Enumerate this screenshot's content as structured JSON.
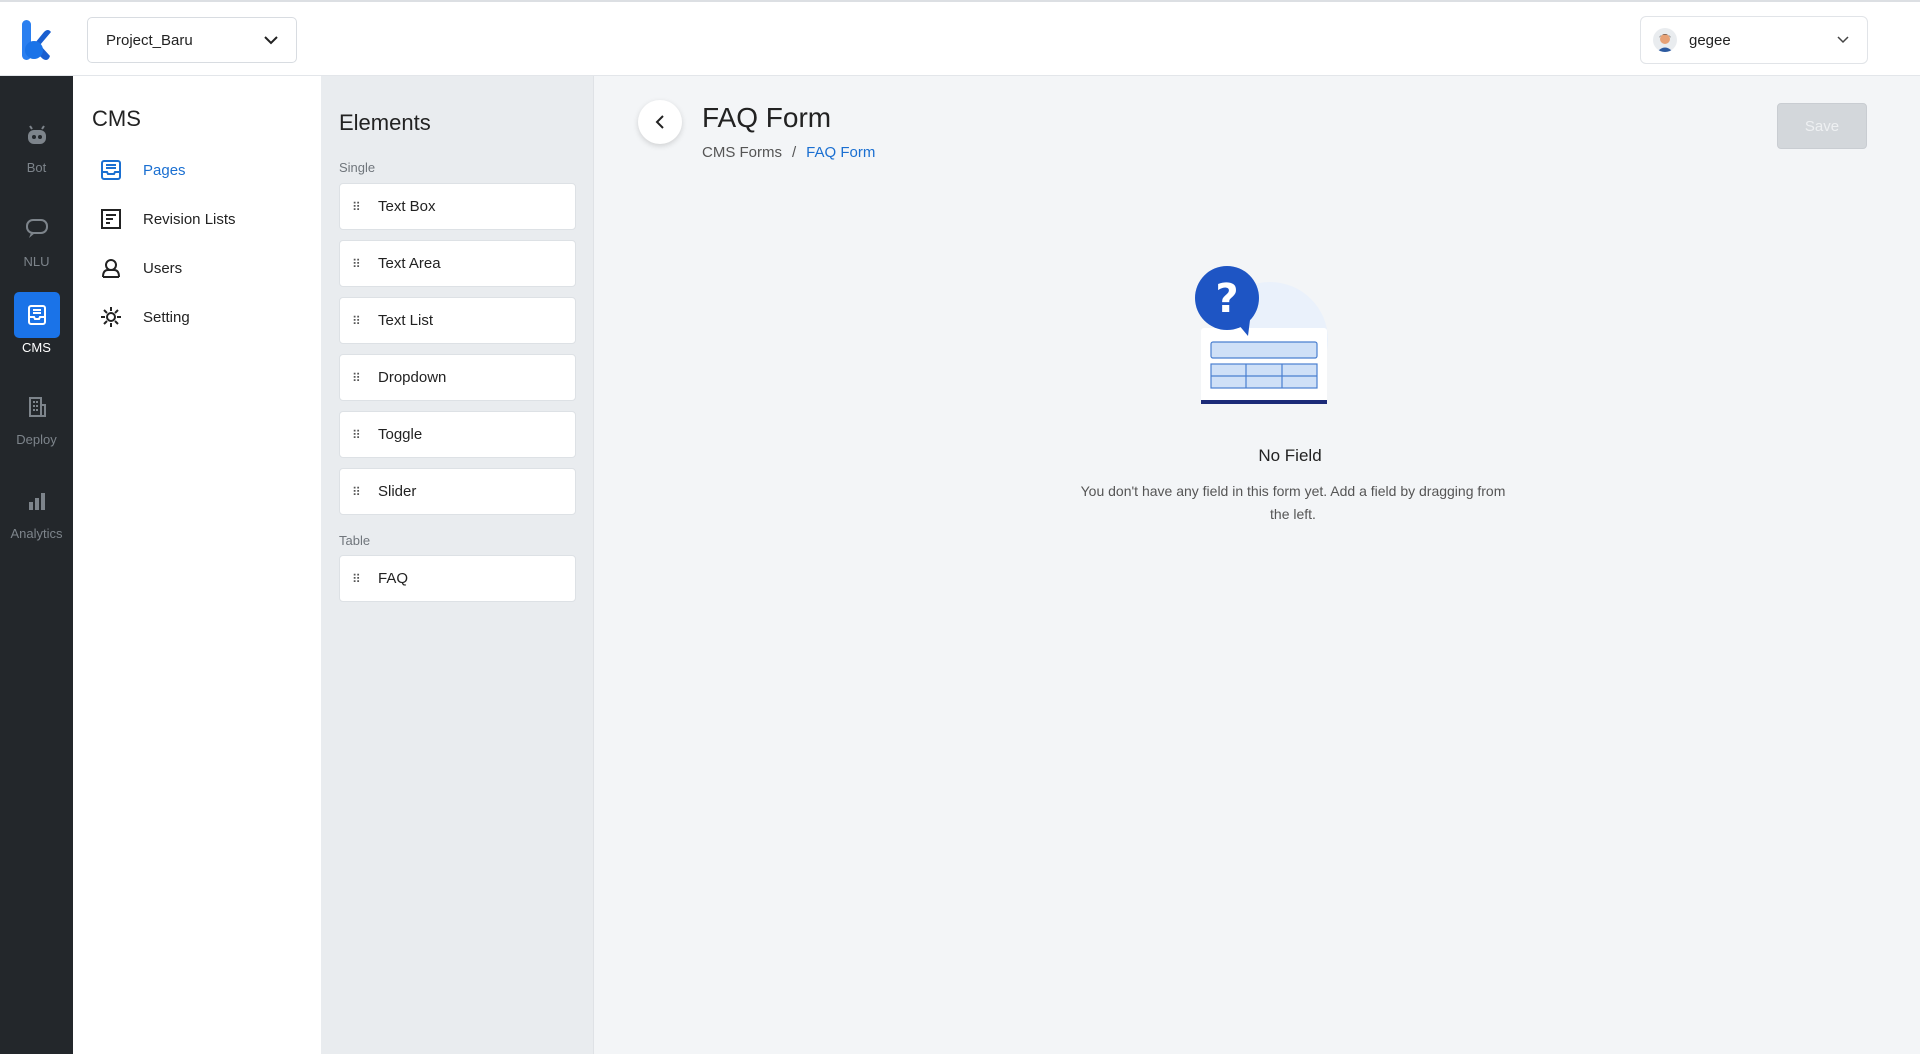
{
  "project": {
    "selected": "Project_Baru"
  },
  "user": {
    "name": "gegee"
  },
  "rail": {
    "items": [
      {
        "label": "Bot",
        "icon": "bot-icon"
      },
      {
        "label": "NLU",
        "icon": "chat-icon"
      },
      {
        "label": "CMS",
        "icon": "inbox-icon",
        "active": true
      },
      {
        "label": "Deploy",
        "icon": "building-icon"
      },
      {
        "label": "Analytics",
        "icon": "bar-chart-icon"
      }
    ]
  },
  "cms_menu": {
    "title": "CMS",
    "items": [
      {
        "label": "Pages",
        "icon": "pages-icon",
        "active": true
      },
      {
        "label": "Revision Lists",
        "icon": "list-icon"
      },
      {
        "label": "Users",
        "icon": "users-icon"
      },
      {
        "label": "Setting",
        "icon": "gear-icon"
      }
    ]
  },
  "elements": {
    "title": "Elements",
    "groups": [
      {
        "label": "Single",
        "items": [
          "Text Box",
          "Text Area",
          "Text List",
          "Dropdown",
          "Toggle",
          "Slider"
        ]
      },
      {
        "label": "Table",
        "items": [
          "FAQ"
        ]
      }
    ]
  },
  "main": {
    "title": "FAQ Form",
    "breadcrumb": [
      "CMS Forms",
      "/",
      "FAQ Form"
    ],
    "save_label": "Save",
    "empty": {
      "title": "No Field",
      "description": "You don't have any field in this form yet. Add a field by dragging from the left."
    }
  },
  "colors": {
    "accent": "#1a73e8",
    "rail_bg": "#23272b",
    "link": "#1a6fd1"
  }
}
